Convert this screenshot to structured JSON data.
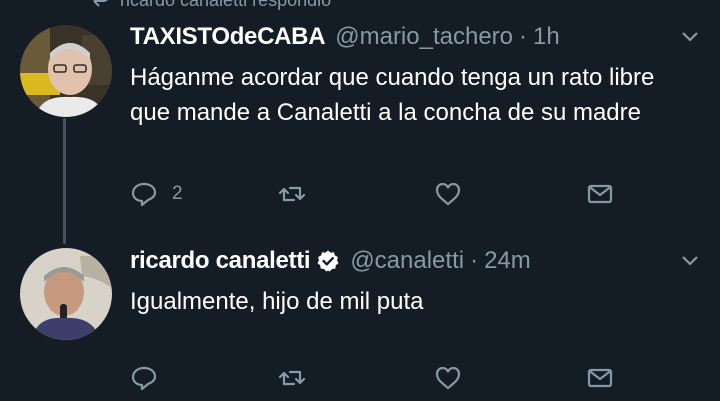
{
  "context": {
    "text": "ricardo canaletti respondió",
    "icon": "reply-context-icon"
  },
  "tweets": [
    {
      "display_name": "TAXISTOdeCABA",
      "handle": "@mario_tachero",
      "separator": "·",
      "time": "1h",
      "verified": false,
      "text": "Háganme acordar que cuando tenga un rato libre que mande a Canaletti a la concha de su madre",
      "reply_count": "2",
      "icons": [
        "reply-icon",
        "retweet-icon",
        "like-icon",
        "message-icon",
        "chevron-down-icon"
      ]
    },
    {
      "display_name": "ricardo canaletti",
      "handle": "@canaletti",
      "separator": "·",
      "time": "24m",
      "verified": true,
      "text": "Igualmente, hijo de mil puta",
      "reply_count": "",
      "icons": [
        "reply-icon",
        "retweet-icon",
        "like-icon",
        "message-icon",
        "chevron-down-icon"
      ]
    }
  ],
  "colors": {
    "background": "#141d26",
    "text": "#ffffff",
    "muted": "#8899a6",
    "thread_line": "#3d5466"
  }
}
